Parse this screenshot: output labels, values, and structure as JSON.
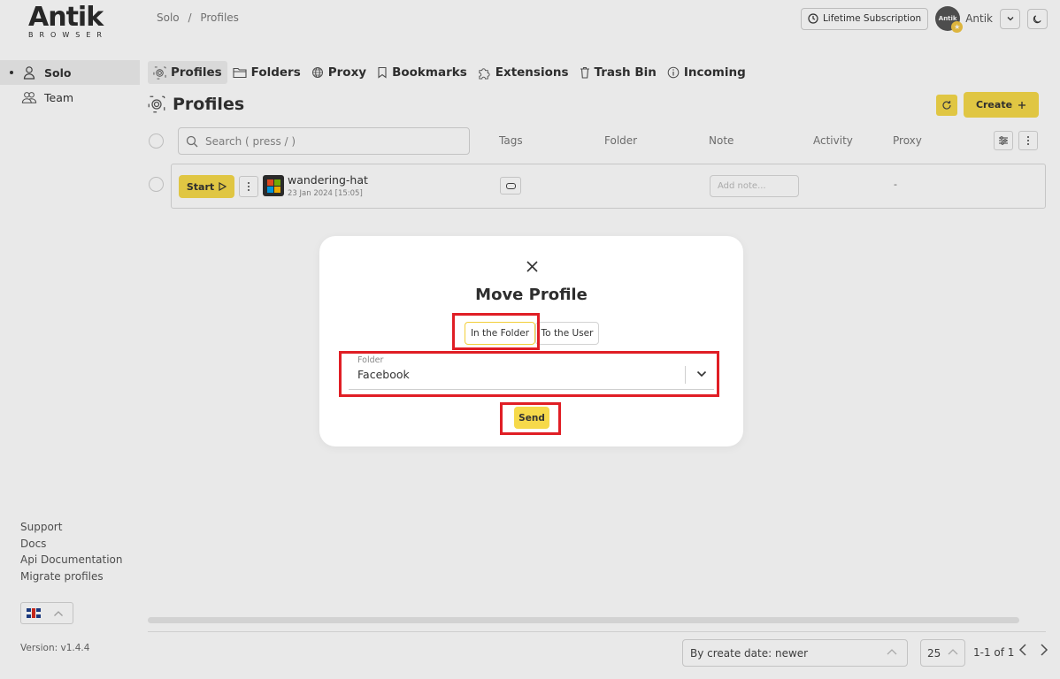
{
  "brand": {
    "name": "Antik",
    "sub": "BROWSER"
  },
  "breadcrumb": {
    "first": "Solo",
    "separator": "/",
    "second": "Profiles"
  },
  "header": {
    "subscription": "Lifetime Subscription",
    "avatar_text": "Antik",
    "user_name": "Antik"
  },
  "sidebar": {
    "items": [
      {
        "label": "Solo",
        "icon": "user-icon",
        "active": true
      },
      {
        "label": "Team",
        "icon": "team-icon",
        "active": false
      }
    ],
    "links": [
      "Support",
      "Docs",
      "Api Documentation",
      "Migrate profiles"
    ],
    "version": "Version: v1.4.4"
  },
  "nav": {
    "tabs": [
      {
        "label": "Profiles",
        "icon": "fingerprint-icon",
        "active": true
      },
      {
        "label": "Folders",
        "icon": "folder-icon"
      },
      {
        "label": "Proxy",
        "icon": "globe-icon"
      },
      {
        "label": "Bookmarks",
        "icon": "bookmark-icon"
      },
      {
        "label": "Extensions",
        "icon": "puzzle-icon"
      },
      {
        "label": "Trash Bin",
        "icon": "trash-icon"
      },
      {
        "label": "Incoming",
        "icon": "info-icon"
      }
    ]
  },
  "page": {
    "title": "Profiles",
    "create_label": "Create"
  },
  "table": {
    "search_placeholder": "Search ( press / )",
    "columns": [
      "Tags",
      "Folder",
      "Note",
      "Activity",
      "Proxy"
    ],
    "rows": [
      {
        "start_label": "Start",
        "name": "wandering-hat",
        "date": "23 Jan 2024 [15:05]",
        "note_placeholder": "Add note...",
        "proxy": "-"
      }
    ]
  },
  "footer": {
    "sort": "By create date: newer",
    "page_size": "25",
    "page_info": "1-1 of 1"
  },
  "modal": {
    "title": "Move Profile",
    "tabs": [
      "In the Folder",
      "To the User"
    ],
    "active_tab": "In the Folder",
    "folder_label": "Folder",
    "folder_value": "Facebook",
    "send_label": "Send"
  },
  "colors": {
    "accent": "#f6d94a",
    "annotation": "#e01e25"
  }
}
